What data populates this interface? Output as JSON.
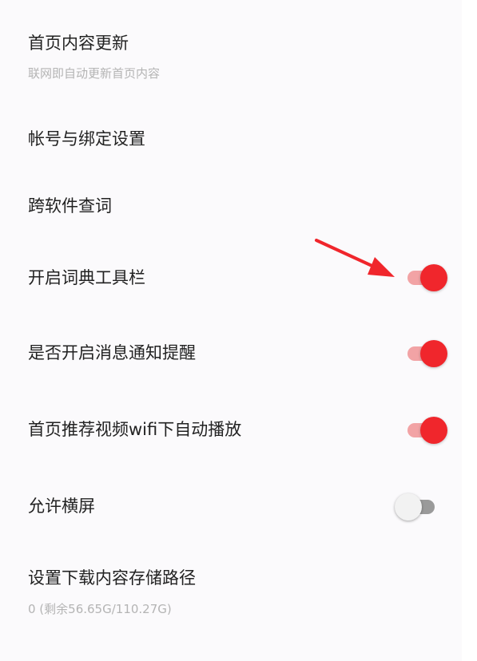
{
  "colors": {
    "accent": "#f0262c",
    "accent_track": "#f2a3a5",
    "off_track": "#9a9a9a",
    "off_knob": "#f2f2f2",
    "annotation_arrow": "#f0262c"
  },
  "settings": [
    {
      "title": "首页内容更新",
      "subtitle": "联网即自动更新首页内容"
    },
    {
      "title": "帐号与绑定设置"
    },
    {
      "title": "跨软件查词"
    },
    {
      "title": "开启词典工具栏",
      "toggle": true
    },
    {
      "title": "是否开启消息通知提醒",
      "toggle": true
    },
    {
      "title": "首页推荐视频wifi下自动播放",
      "toggle": true
    },
    {
      "title": "允许横屏",
      "toggle": false
    },
    {
      "title": "设置下载内容存储路径",
      "subtitle": "0 (剩余56.65G/110.27G)"
    }
  ],
  "annotation": {
    "icon": "red-arrow-icon",
    "points_to": "开启词典工具栏"
  }
}
